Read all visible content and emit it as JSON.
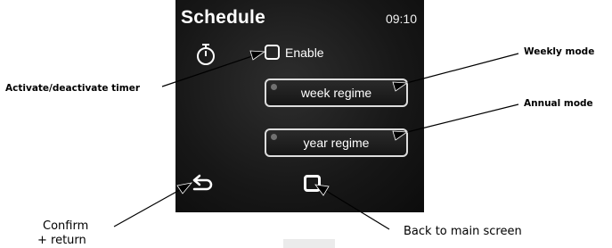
{
  "screen": {
    "title": "Schedule",
    "time": "09:10",
    "enable_label": "Enable",
    "enable_checked": false,
    "week_button": "week regime",
    "year_button": "year regime"
  },
  "callouts": {
    "weekly": "Weekly mode",
    "annual": "Annual mode",
    "timer": "Activate/deactivate timer",
    "confirm_line1": "Confirm",
    "confirm_line2": "+ return",
    "back": "Back to main screen"
  },
  "icons": [
    "stopwatch-icon",
    "return-arrow-icon",
    "home-square-icon"
  ],
  "colors": {
    "screen_bg": "#171717",
    "button_border": "#dcdcdc",
    "text": "#ffffff"
  }
}
